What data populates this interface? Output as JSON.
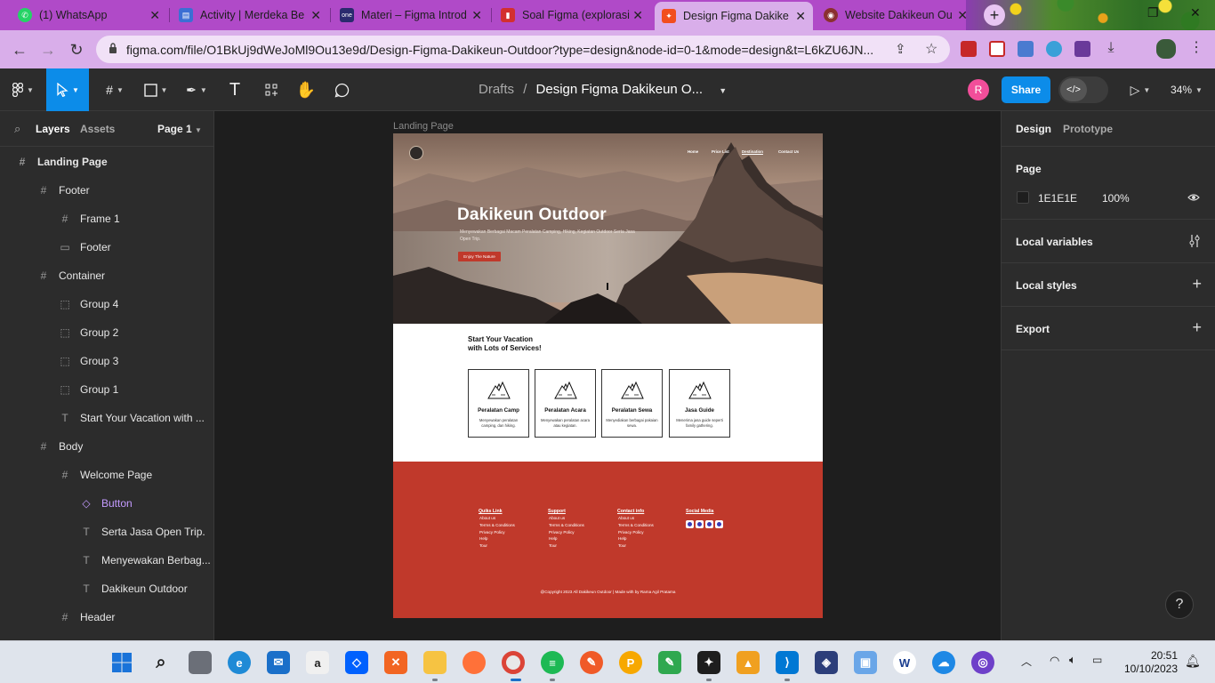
{
  "browser": {
    "tabs": [
      {
        "title": "(1) WhatsApp",
        "icon": "whatsapp-icon",
        "color": "#25d366",
        "active": false
      },
      {
        "title": "Activity | Merdeka Be",
        "icon": "merdeka-icon",
        "color": "#3b6fd4",
        "active": false
      },
      {
        "title": "Materi – Figma Introd",
        "icon": "one-icon",
        "color": "#2a2a6e",
        "active": false
      },
      {
        "title": "Soal Figma (explorasi",
        "icon": "pdf-icon",
        "color": "#d32f2f",
        "active": false
      },
      {
        "title": "Design Figma Dakike",
        "icon": "figma-icon",
        "color": "#f24e1e",
        "active": true
      },
      {
        "title": "Website Dakikeun Ou",
        "icon": "site-icon",
        "color": "#8a3030",
        "active": false
      }
    ],
    "url": "figma.com/file/O1BkUj9dWeJoMl9Ou13e9d/Design-Figma-Dakikeun-Outdoor?type=design&node-id=0-1&mode=design&t=L6kZU6JN..."
  },
  "figma": {
    "breadcrumb": {
      "parent": "Drafts",
      "separator": "/",
      "current": "Design Figma Dakikeun O..."
    },
    "avatar": "R",
    "share_label": "Share",
    "zoom": "34%",
    "dev_mode_symbol": "</>"
  },
  "left_panel": {
    "tab_layers": "Layers",
    "tab_assets": "Assets",
    "page_selector": "Page 1",
    "layers": [
      {
        "label": "Landing Page",
        "depth": 0,
        "type": "frame"
      },
      {
        "label": "Footer",
        "depth": 1,
        "type": "frame"
      },
      {
        "label": "Frame 1",
        "depth": 2,
        "type": "frame"
      },
      {
        "label": "Footer",
        "depth": 2,
        "type": "rect"
      },
      {
        "label": "Container",
        "depth": 1,
        "type": "frame"
      },
      {
        "label": "Group 4",
        "depth": 2,
        "type": "group"
      },
      {
        "label": "Group 2",
        "depth": 2,
        "type": "group"
      },
      {
        "label": "Group 3",
        "depth": 2,
        "type": "group"
      },
      {
        "label": "Group 1",
        "depth": 2,
        "type": "group"
      },
      {
        "label": "Start Your Vacation with ...",
        "depth": 2,
        "type": "text"
      },
      {
        "label": "Body",
        "depth": 1,
        "type": "frame"
      },
      {
        "label": "Welcome Page",
        "depth": 2,
        "type": "frame"
      },
      {
        "label": "Button",
        "depth": 3,
        "type": "component"
      },
      {
        "label": "Serta Jasa Open Trip.",
        "depth": 3,
        "type": "text"
      },
      {
        "label": "Menyewakan Berbag...",
        "depth": 3,
        "type": "text"
      },
      {
        "label": "Dakikeun Outdoor",
        "depth": 3,
        "type": "text"
      },
      {
        "label": "Header",
        "depth": 2,
        "type": "frame"
      }
    ]
  },
  "canvas": {
    "frame_label": "Landing Page",
    "hero": {
      "nav": [
        "Home",
        "Price List",
        "Destination",
        "Contact Us"
      ],
      "title": "Dakikeun Outdoor",
      "subtitle": "Menyewakan Berbagai Macam Peralatan Camping, Hiking, Kegiatan Outdoor Serta Jasa Open Trip.",
      "button": "Enjoy The Nature"
    },
    "services": {
      "title": "Start Your Vacation\nwith Lots of Services!",
      "cards": [
        {
          "title": "Peralatan Camp",
          "desc": "Menyewakan peralatan camping, dan hiking."
        },
        {
          "title": "Peralatan Acara",
          "desc": "Menyewakan peralatan acara atau kegiatan."
        },
        {
          "title": "Peralatan Sewa",
          "desc": "Menyediakan berbagai pakaian sewa."
        },
        {
          "title": "Jasa Guide",
          "desc": "Menerima jasa guide seperti family gathering."
        }
      ]
    },
    "footer": {
      "columns": [
        {
          "heading": "Quiks Link",
          "links": [
            "About us",
            "Terms & Conditions",
            "Privacy Policy",
            "Help",
            "Tour"
          ]
        },
        {
          "heading": "Support",
          "links": [
            "About us",
            "Terms & Conditions",
            "Privacy Policy",
            "Help",
            "Tour"
          ]
        },
        {
          "heading": "Contact info",
          "links": [
            "About us",
            "Terms & Conditions",
            "Privacy Policy",
            "Help",
            "Tour"
          ]
        }
      ],
      "social_heading": "Social Media",
      "social_icons": [
        "discord-icon",
        "instagram-icon",
        "linkedin-icon",
        "youtube-icon"
      ],
      "copyright": "@Copyright 2023 All Dakikeun Outdoor | Made with by Rama Agil Pratama"
    }
  },
  "right_panel": {
    "tab_design": "Design",
    "tab_prototype": "Prototype",
    "page_heading": "Page",
    "page_color": "1E1E1E",
    "page_opacity": "100%",
    "local_variables": "Local variables",
    "local_styles": "Local styles",
    "export": "Export",
    "help": "?"
  },
  "taskbar": {
    "time": "20:51",
    "date": "10/10/2023"
  }
}
